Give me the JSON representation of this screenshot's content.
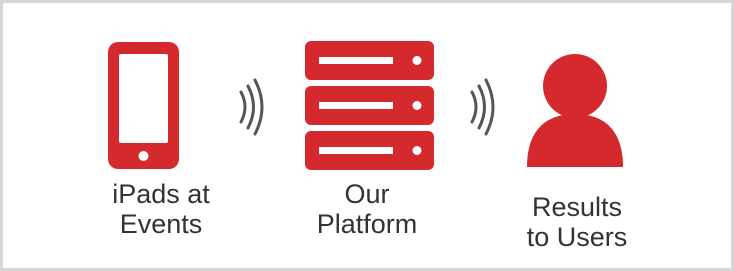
{
  "nodes": [
    {
      "id": "ipads",
      "icon": "tablet-icon",
      "label_lines": [
        "iPads at",
        "Events"
      ]
    },
    {
      "id": "platform",
      "icon": "server-stack-icon",
      "label_lines": [
        "Our",
        "Platform"
      ]
    },
    {
      "id": "results",
      "icon": "user-icon",
      "label_lines": [
        "Results",
        "to Users"
      ]
    }
  ],
  "connectors": [
    {
      "from": "ipads",
      "to": "platform",
      "icon": "wireless-signal-icon"
    },
    {
      "from": "platform",
      "to": "results",
      "icon": "wireless-signal-icon"
    }
  ],
  "colors": {
    "accent": "#d42a2e",
    "text": "#333333",
    "border": "#d6d6d6",
    "signal": "#555555"
  }
}
